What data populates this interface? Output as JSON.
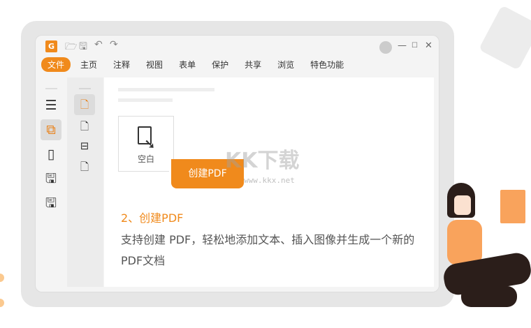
{
  "toolbar": {
    "logo": "G",
    "quick_icons": [
      "open-folder-icon",
      "save-icon",
      "undo-icon",
      "redo-icon"
    ]
  },
  "menu": [
    "文件",
    "主页",
    "注释",
    "视图",
    "表单",
    "保护",
    "共享",
    "浏览",
    "特色功能"
  ],
  "window_controls": {
    "min": "—",
    "max": "☐",
    "close": "✕"
  },
  "card": {
    "label": "空白"
  },
  "tooltip": "创建PDF",
  "step_title": "2、创建PDF",
  "description": "支持创建 PDF，轻松地添加文本、插入图像并生成一个新的PDF文档",
  "watermark": {
    "text": "KK下载",
    "url": "www.kkx.net"
  },
  "colors": {
    "accent": "#f08a1c"
  }
}
